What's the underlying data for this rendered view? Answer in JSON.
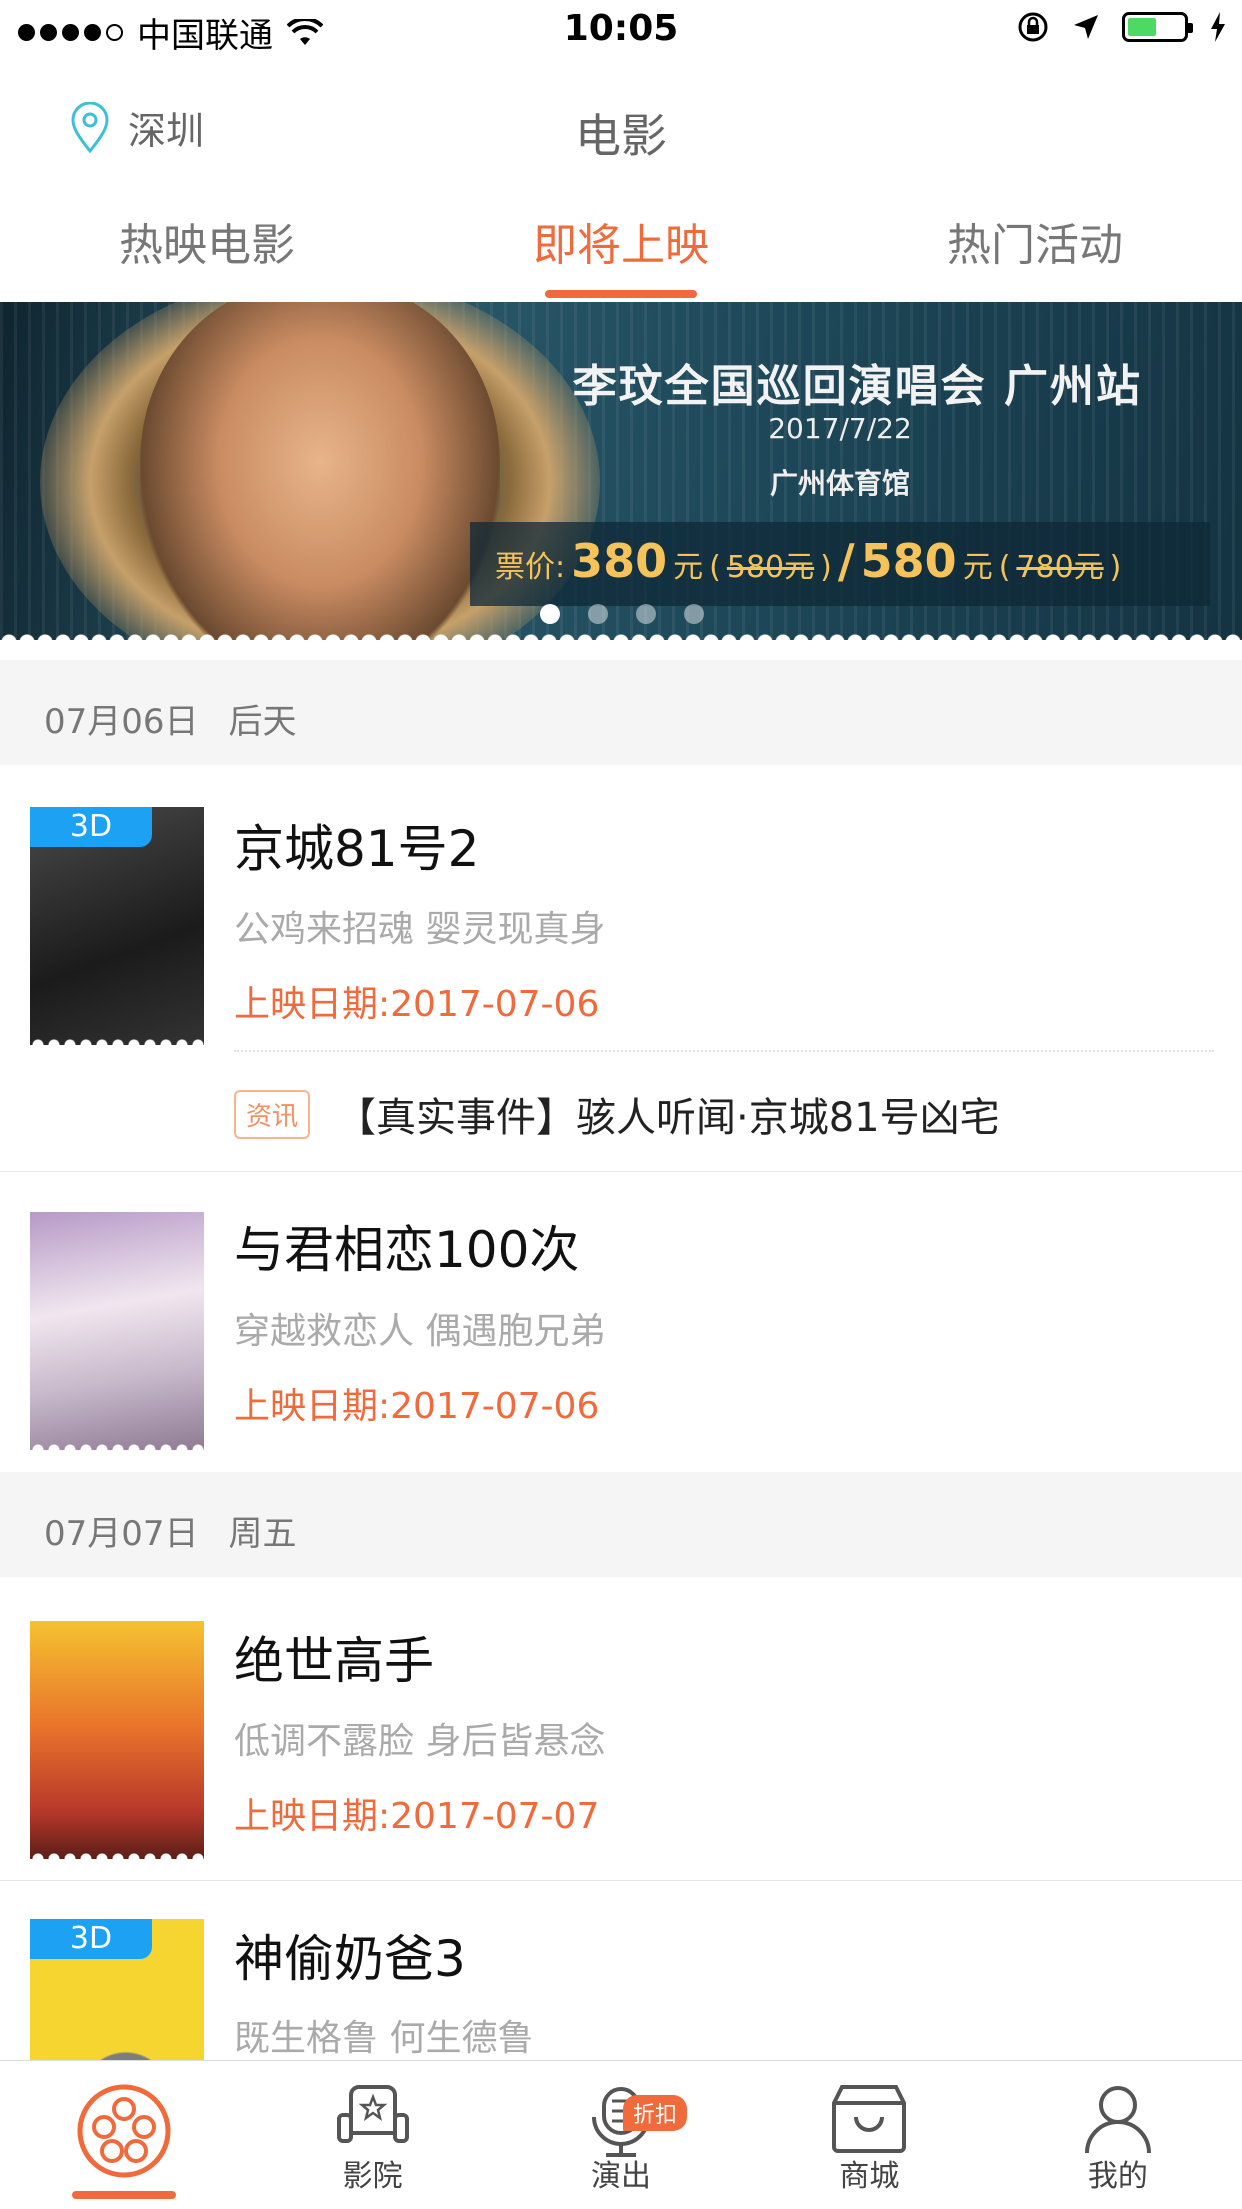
{
  "status": {
    "carrier": "中国联通",
    "time": "10:05"
  },
  "nav": {
    "city": "深圳",
    "title": "电影"
  },
  "tabs": [
    "热映电影",
    "即将上映",
    "热门活动"
  ],
  "banner": {
    "title": "李玟全国巡回演唱会 广州站",
    "date": "2017/7/22",
    "venue": "广州体育馆",
    "price_label": "票价:",
    "price1": "380",
    "unit1": "元",
    "orig1": "580元",
    "slash": "/",
    "price2": "580",
    "unit2": "元",
    "orig2": "780元",
    "paren_open": "(",
    "paren_close": ")"
  },
  "sections": [
    {
      "date": "07月06日",
      "day": "后天"
    },
    {
      "date": "07月07日",
      "day": "周五"
    }
  ],
  "movies": [
    {
      "badge": "3D",
      "title": "京城81号2",
      "subtitle": "公鸡来招魂 婴灵现真身",
      "release": "上映日期:2017-07-06",
      "news_tag": "资讯",
      "news": "【真实事件】骇人听闻·京城81号凶宅"
    },
    {
      "title": "与君相恋100次",
      "subtitle": "穿越救恋人 偶遇胞兄弟",
      "release": "上映日期:2017-07-06"
    },
    {
      "title": "绝世高手",
      "subtitle": "低调不露脸 身后皆悬念",
      "release": "上映日期:2017-07-07"
    },
    {
      "badge": "3D",
      "title": "神偷奶爸3",
      "subtitle": "既生格鲁 何生德鲁"
    }
  ],
  "tabbar": [
    "",
    "影院",
    "演出",
    "商城",
    "我的"
  ],
  "tabbar_badge": "折扣",
  "colors": {
    "accent": "#f06a3b",
    "badge3d": "#1da1f2"
  },
  "icons": [
    "signal-dots-icon",
    "wifi-icon",
    "lock-rotation-icon",
    "location-arrow-icon",
    "battery-icon",
    "charging-icon",
    "location-pin-icon",
    "film-reel-icon",
    "cinema-seat-icon",
    "microphone-icon",
    "shopping-bag-icon",
    "person-icon"
  ]
}
